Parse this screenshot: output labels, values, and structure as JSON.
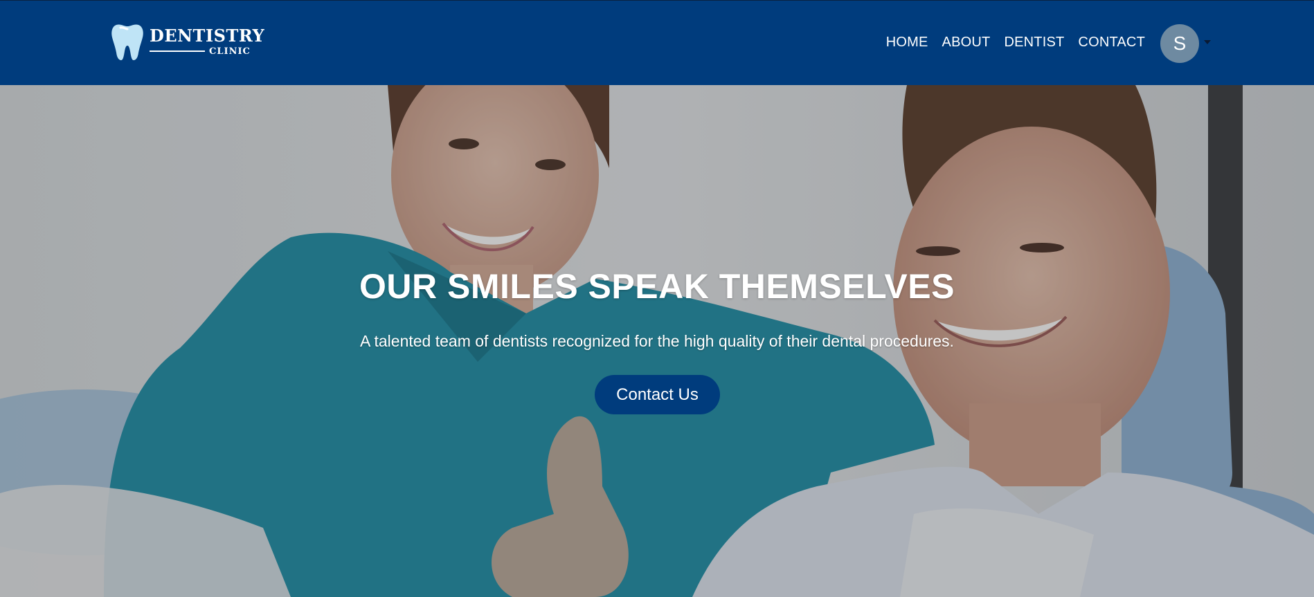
{
  "brand": {
    "name": "DENTISTRY",
    "subtitle": "CLINIC",
    "icon": "tooth-icon"
  },
  "nav": {
    "items": [
      {
        "label": "HOME"
      },
      {
        "label": "ABOUT"
      },
      {
        "label": "DENTIST"
      },
      {
        "label": "CONTACT"
      }
    ]
  },
  "user": {
    "avatar_initial": "S",
    "menu_icon": "caret-down-icon"
  },
  "hero": {
    "title": "OUR SMILES SPEAK THEMSELVES",
    "subtitle": "A talented team of dentists recognized for the high quality of their dental procedures.",
    "cta_label": "Contact Us"
  },
  "colors": {
    "primary": "#003c7d",
    "avatar": "#6e8aa1",
    "text_light": "#ffffff"
  }
}
